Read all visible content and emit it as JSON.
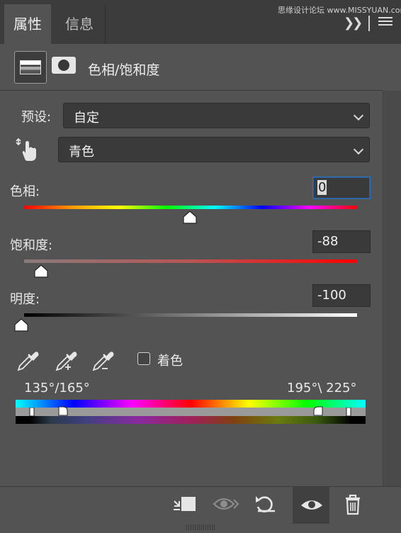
{
  "tabs": [
    {
      "label": "属性",
      "active": true
    },
    {
      "label": "信息",
      "active": false
    }
  ],
  "watermark": "思缘设计论坛 www.MISSYUAN.com",
  "adjustment": {
    "title": "色相/饱和度",
    "preset_label": "预设:",
    "preset_value": "自定",
    "channel_value": "青色"
  },
  "hue": {
    "label": "色相:",
    "value": "0"
  },
  "saturation": {
    "label": "饱和度:",
    "value": "-88"
  },
  "lightness": {
    "label": "明度:",
    "value": "-100"
  },
  "colorize_label": "着色",
  "range": {
    "left": "135°/165°",
    "right": "195°\\ 225°"
  },
  "icons": {
    "collapse": "double-chevron-right-icon",
    "menu": "panel-menu-icon",
    "adjustment": "hue-saturation-icon",
    "mask": "mask-icon",
    "target": "targeted-adjustment-hand-icon"
  },
  "colors": {
    "panel": "#535353",
    "tabbar": "#3c3c3c",
    "field": "#3a3a3a",
    "focus": "#2f6fb5"
  }
}
